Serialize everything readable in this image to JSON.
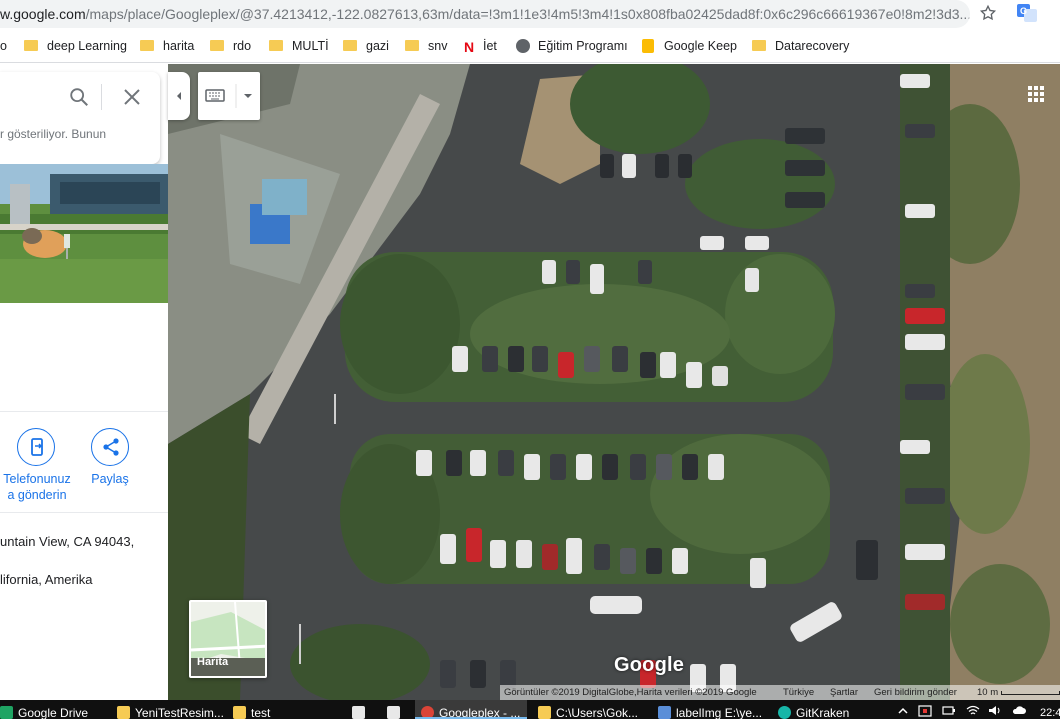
{
  "browser": {
    "url_host": "w.google.com",
    "url_path": "/maps/place/Googleplex/@37.4213412,-122.0827613,63m/data=!3m1!1e3!4m5!3m4!1s0x808fba02425dad8f:0x6c296c66619367e0!8m2!3d3...",
    "star_icon": "star-outline-icon",
    "extension_icon": "google-translate-icon"
  },
  "bookmarks": [
    {
      "label": "o",
      "icon": "folder-icon"
    },
    {
      "label": "deep Learning",
      "icon": "folder-icon"
    },
    {
      "label": "harita",
      "icon": "folder-icon"
    },
    {
      "label": "rdo",
      "icon": "folder-icon"
    },
    {
      "label": "MULTİ",
      "icon": "folder-icon"
    },
    {
      "label": "gazi",
      "icon": "folder-icon"
    },
    {
      "label": "snv",
      "icon": "folder-icon"
    },
    {
      "label": "İet",
      "icon": "netflix-icon"
    },
    {
      "label": "Eğitim Programı",
      "icon": "globe-icon"
    },
    {
      "label": "Google Keep",
      "icon": "keep-icon"
    },
    {
      "label": "Datarecovery",
      "icon": "folder-icon"
    }
  ],
  "panel": {
    "search": {
      "value": "",
      "placeholder": ""
    },
    "search_hint": "r gösteriliyor. Bunun",
    "actions": [
      {
        "icon": "send-to-phone-icon",
        "line1": "Telefonunuz",
        "line2": "a gönderin"
      },
      {
        "icon": "share-icon",
        "line1": "Paylaş",
        "line2": ""
      }
    ],
    "address_line1": "untain View, CA 94043,",
    "address_line2": "lifornia, Amerika"
  },
  "map": {
    "layer_toggle_label": "Harita",
    "logo": "Google",
    "attribution": {
      "imagery": "Görüntüler ©2019 DigitalGlobe,Harita verileri ©2019 Google",
      "country": "Türkiye",
      "terms": "Şartlar",
      "feedback": "Geri bildirim gönder",
      "scale": "10 m"
    }
  },
  "taskbar": {
    "items": [
      {
        "label": "Google Drive",
        "icon": "drive-icon"
      },
      {
        "label": "YeniTestResim...",
        "icon": "folder-icon"
      },
      {
        "label": "test",
        "icon": "folder-icon"
      },
      {
        "label": "",
        "icon": "store-icon"
      },
      {
        "label": "",
        "icon": "mail-icon"
      },
      {
        "label": "Googleplex - ...",
        "icon": "chrome-icon"
      },
      {
        "label": "C:\\Users\\Gok...",
        "icon": "explorer-icon"
      },
      {
        "label": "labelImg E:\\ye...",
        "icon": "labelimg-icon"
      },
      {
        "label": "GitKraken",
        "icon": "gitkraken-icon"
      }
    ],
    "clock": "22:4"
  },
  "colors": {
    "accent": "#1a73e8",
    "taskbar": "#101010",
    "folder": "#f6cb54"
  }
}
